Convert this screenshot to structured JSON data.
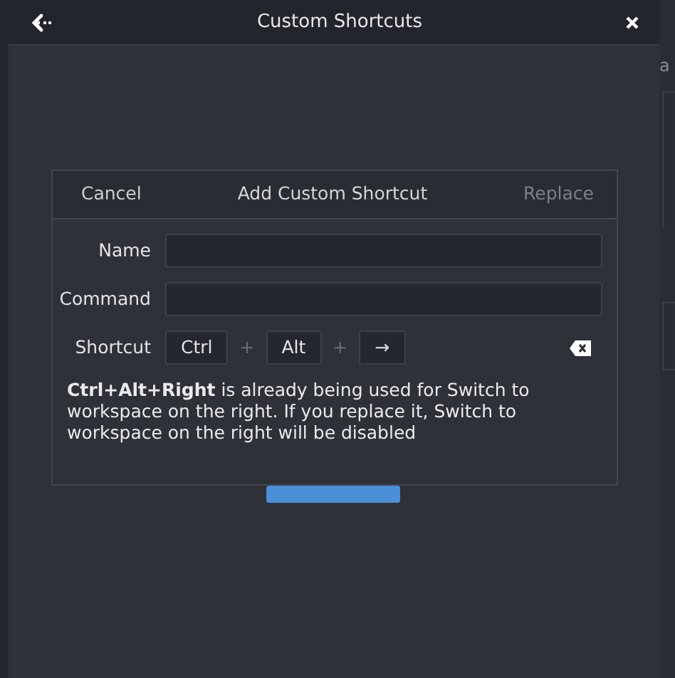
{
  "window": {
    "title": "Custom Shortcuts"
  },
  "background": {
    "side_text": "a"
  },
  "dialog": {
    "title": "Add Custom Shortcut",
    "cancel": "Cancel",
    "replace": {
      "label": "Replace",
      "disabled": true
    },
    "fields": [
      {
        "label": "Name"
      },
      {
        "label": "Command"
      }
    ],
    "shortcut": {
      "label": "Shortcut",
      "keys": [
        "Ctrl",
        "Alt",
        "→"
      ],
      "separator": "+"
    },
    "message": "**Ctrl+Alt+Right** is already being used for Switch to workspace on the right. If you replace it, Switch to workspace on the right will be disabled"
  }
}
